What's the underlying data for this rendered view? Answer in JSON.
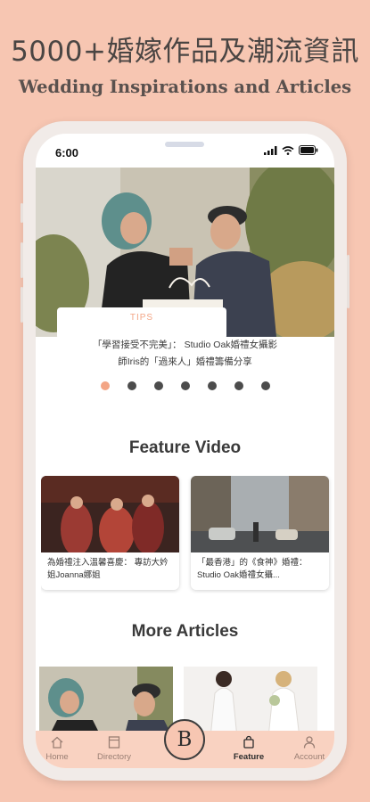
{
  "promo": {
    "headline": "5000+婚嫁作品及潮流資訊",
    "subheadline": "Wedding Inspirations and Articles"
  },
  "status_bar": {
    "time": "6:00"
  },
  "hero": {
    "tag": "TIPS",
    "caption_line1": "「學習接受不完美」： Studio Oak婚禮女攝影",
    "caption_line2": "師Iris的「過來人」婚禮籌備分享",
    "slide_count": 7,
    "active_slide": 0
  },
  "feature_video": {
    "title": "Feature Video",
    "items": [
      {
        "title": "為婚禮注入溫馨喜慶： 專訪大妗姐Joanna娜姐"
      },
      {
        "title": "「最香港」的《食神》婚禮：Studio Oak婚禮女攝..."
      }
    ]
  },
  "more_articles": {
    "title": "More Articles"
  },
  "tab_bar": {
    "items": [
      {
        "label": "Home",
        "icon": "home-icon"
      },
      {
        "label": "Directory",
        "icon": "directory-icon"
      },
      {
        "label": "Feature",
        "icon": "bag-icon"
      },
      {
        "label": "Account",
        "icon": "person-icon"
      }
    ],
    "center_logo": "B",
    "active": "Feature"
  },
  "colors": {
    "background": "#f7c6b2",
    "accent": "#f3a585",
    "tab_bar": "#f9d2c1"
  }
}
